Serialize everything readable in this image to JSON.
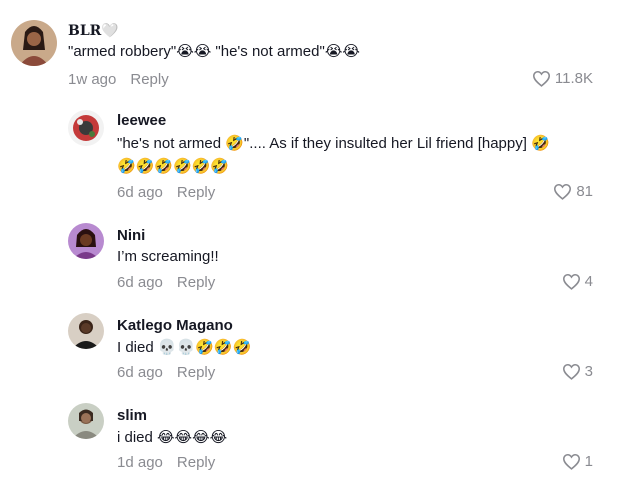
{
  "colors": {
    "text": "#161823",
    "secondary": "#8a8b91",
    "emoji_yellow": "#f7c12a"
  },
  "comments": [
    {
      "username": "BLR🤍",
      "text": "\"armed robbery\"😭😭 \"he's not armed\"😭😭",
      "time": "1w ago",
      "reply_label": "Reply",
      "likes": "11.8K"
    },
    {
      "username": "leewee",
      "text_line1": "\"he's not armed 🤣\".... As if they insulted her Lil friend [happy] 🤣",
      "text_line2": "🤣🤣🤣🤣🤣🤣",
      "time": "6d ago",
      "reply_label": "Reply",
      "likes": "81"
    },
    {
      "username": "Nini",
      "text": "I’m screaming!!",
      "time": "6d ago",
      "reply_label": "Reply",
      "likes": "4"
    },
    {
      "username": "Katlego Magano",
      "text": "I died 💀💀🤣🤣🤣",
      "time": "6d ago",
      "reply_label": "Reply",
      "likes": "3"
    },
    {
      "username": "slim",
      "text": "i died 😂😂😂😂",
      "time": "1d ago",
      "reply_label": "Reply",
      "likes": "1"
    }
  ]
}
